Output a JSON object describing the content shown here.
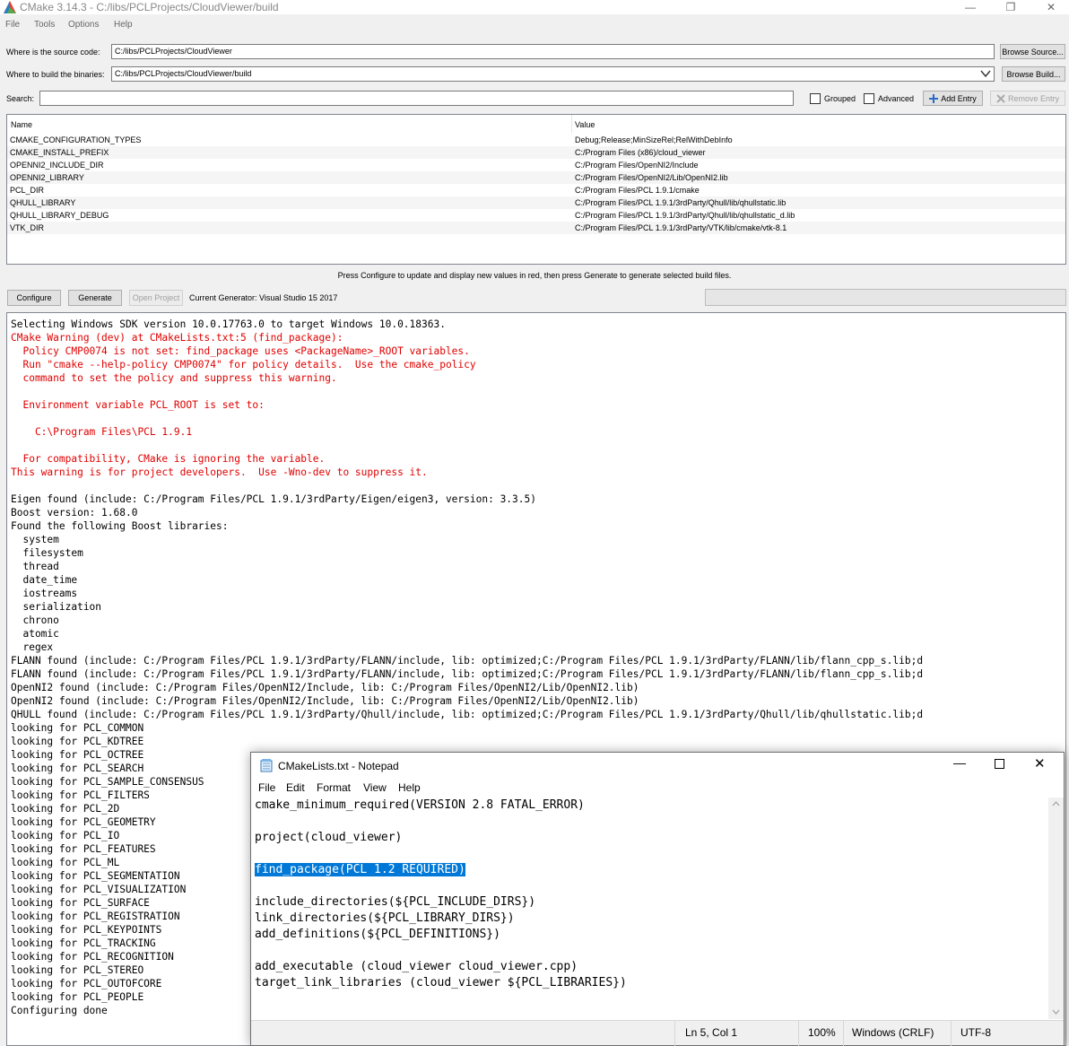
{
  "window": {
    "title": "CMake 3.14.3 - C:/libs/PCLProjects/CloudViewer/build",
    "controls": {
      "minimize": "—",
      "restore": "❐",
      "close": "✕"
    }
  },
  "menu": [
    "File",
    "Tools",
    "Options",
    "Help"
  ],
  "source": {
    "label": "Where is the source code:",
    "value": "C:/libs/PCLProjects/CloudViewer",
    "browse": "Browse Source..."
  },
  "build": {
    "label": "Where to build the binaries:",
    "value": "C:/libs/PCLProjects/CloudViewer/build",
    "browse": "Browse Build..."
  },
  "search": {
    "label": "Search:",
    "value": ""
  },
  "options": {
    "grouped": "Grouped",
    "advanced": "Advanced",
    "add_entry": "Add Entry",
    "remove_entry": "Remove Entry"
  },
  "cache_table": {
    "headers": [
      "Name",
      "Value"
    ],
    "rows": [
      [
        "CMAKE_CONFIGURATION_TYPES",
        "Debug;Release;MinSizeRel;RelWithDebInfo"
      ],
      [
        "CMAKE_INSTALL_PREFIX",
        "C:/Program Files (x86)/cloud_viewer"
      ],
      [
        "OPENNI2_INCLUDE_DIR",
        "C:/Program Files/OpenNI2/Include"
      ],
      [
        "OPENNI2_LIBRARY",
        "C:/Program Files/OpenNI2/Lib/OpenNI2.lib"
      ],
      [
        "PCL_DIR",
        "C:/Program Files/PCL 1.9.1/cmake"
      ],
      [
        "QHULL_LIBRARY",
        "C:/Program Files/PCL 1.9.1/3rdParty/Qhull/lib/qhullstatic.lib"
      ],
      [
        "QHULL_LIBRARY_DEBUG",
        "C:/Program Files/PCL 1.9.1/3rdParty/Qhull/lib/qhullstatic_d.lib"
      ],
      [
        "VTK_DIR",
        "C:/Program Files/PCL 1.9.1/3rdParty/VTK/lib/cmake/vtk-8.1"
      ]
    ]
  },
  "hint": "Press Configure to update and display new values in red, then press Generate to generate selected build files.",
  "actions": {
    "configure": "Configure",
    "generate": "Generate",
    "open_project": "Open Project",
    "generator": "Current Generator: Visual Studio 15 2017"
  },
  "output": [
    {
      "t": "Selecting Windows SDK version 10.0.17763.0 to target Windows 10.0.18363.",
      "c": "n"
    },
    {
      "t": "CMake Warning (dev) at CMakeLists.txt:5 (find_package):",
      "c": "r"
    },
    {
      "t": "  Policy CMP0074 is not set: find_package uses <PackageName>_ROOT variables.",
      "c": "r"
    },
    {
      "t": "  Run \"cmake --help-policy CMP0074\" for policy details.  Use the cmake_policy",
      "c": "r"
    },
    {
      "t": "  command to set the policy and suppress this warning.",
      "c": "r"
    },
    {
      "t": "",
      "c": "r"
    },
    {
      "t": "  Environment variable PCL_ROOT is set to:",
      "c": "r"
    },
    {
      "t": "",
      "c": "r"
    },
    {
      "t": "    C:\\Program Files\\PCL 1.9.1",
      "c": "r"
    },
    {
      "t": "",
      "c": "r"
    },
    {
      "t": "  For compatibility, CMake is ignoring the variable.",
      "c": "r"
    },
    {
      "t": "This warning is for project developers.  Use -Wno-dev to suppress it.",
      "c": "r"
    },
    {
      "t": "",
      "c": "n"
    },
    {
      "t": "Eigen found (include: C:/Program Files/PCL 1.9.1/3rdParty/Eigen/eigen3, version: 3.3.5)",
      "c": "n"
    },
    {
      "t": "Boost version: 1.68.0",
      "c": "n"
    },
    {
      "t": "Found the following Boost libraries:",
      "c": "n"
    },
    {
      "t": "  system",
      "c": "n"
    },
    {
      "t": "  filesystem",
      "c": "n"
    },
    {
      "t": "  thread",
      "c": "n"
    },
    {
      "t": "  date_time",
      "c": "n"
    },
    {
      "t": "  iostreams",
      "c": "n"
    },
    {
      "t": "  serialization",
      "c": "n"
    },
    {
      "t": "  chrono",
      "c": "n"
    },
    {
      "t": "  atomic",
      "c": "n"
    },
    {
      "t": "  regex",
      "c": "n"
    },
    {
      "t": "FLANN found (include: C:/Program Files/PCL 1.9.1/3rdParty/FLANN/include, lib: optimized;C:/Program Files/PCL 1.9.1/3rdParty/FLANN/lib/flann_cpp_s.lib;d",
      "c": "n"
    },
    {
      "t": "FLANN found (include: C:/Program Files/PCL 1.9.1/3rdParty/FLANN/include, lib: optimized;C:/Program Files/PCL 1.9.1/3rdParty/FLANN/lib/flann_cpp_s.lib;d",
      "c": "n"
    },
    {
      "t": "OpenNI2 found (include: C:/Program Files/OpenNI2/Include, lib: C:/Program Files/OpenNI2/Lib/OpenNI2.lib)",
      "c": "n"
    },
    {
      "t": "OpenNI2 found (include: C:/Program Files/OpenNI2/Include, lib: C:/Program Files/OpenNI2/Lib/OpenNI2.lib)",
      "c": "n"
    },
    {
      "t": "QHULL found (include: C:/Program Files/PCL 1.9.1/3rdParty/Qhull/include, lib: optimized;C:/Program Files/PCL 1.9.1/3rdParty/Qhull/lib/qhullstatic.lib;d",
      "c": "n"
    },
    {
      "t": "looking for PCL_COMMON",
      "c": "n"
    },
    {
      "t": "looking for PCL_KDTREE",
      "c": "n"
    },
    {
      "t": "looking for PCL_OCTREE",
      "c": "n"
    },
    {
      "t": "looking for PCL_SEARCH",
      "c": "n"
    },
    {
      "t": "looking for PCL_SAMPLE_CONSENSUS",
      "c": "n"
    },
    {
      "t": "looking for PCL_FILTERS",
      "c": "n"
    },
    {
      "t": "looking for PCL_2D",
      "c": "n"
    },
    {
      "t": "looking for PCL_GEOMETRY",
      "c": "n"
    },
    {
      "t": "looking for PCL_IO",
      "c": "n"
    },
    {
      "t": "looking for PCL_FEATURES",
      "c": "n"
    },
    {
      "t": "looking for PCL_ML",
      "c": "n"
    },
    {
      "t": "looking for PCL_SEGMENTATION",
      "c": "n"
    },
    {
      "t": "looking for PCL_VISUALIZATION",
      "c": "n"
    },
    {
      "t": "looking for PCL_SURFACE",
      "c": "n"
    },
    {
      "t": "looking for PCL_REGISTRATION",
      "c": "n"
    },
    {
      "t": "looking for PCL_KEYPOINTS",
      "c": "n"
    },
    {
      "t": "looking for PCL_TRACKING",
      "c": "n"
    },
    {
      "t": "looking for PCL_RECOGNITION",
      "c": "n"
    },
    {
      "t": "looking for PCL_STEREO",
      "c": "n"
    },
    {
      "t": "looking for PCL_OUTOFCORE",
      "c": "n"
    },
    {
      "t": "looking for PCL_PEOPLE",
      "c": "n"
    },
    {
      "t": "Configuring done",
      "c": "n"
    }
  ],
  "notepad": {
    "title": "CMakeLists.txt - Notepad",
    "menu": [
      "File",
      "Edit",
      "Format",
      "View",
      "Help"
    ],
    "lines": [
      "cmake_minimum_required(VERSION 2.8 FATAL_ERROR)",
      "",
      "project(cloud_viewer)",
      "",
      "find_package(PCL 1.2 REQUIRED)",
      "",
      "include_directories(${PCL_INCLUDE_DIRS})",
      "link_directories(${PCL_LIBRARY_DIRS})",
      "add_definitions(${PCL_DEFINITIONS})",
      "",
      "add_executable (cloud_viewer cloud_viewer.cpp)",
      "target_link_libraries (cloud_viewer ${PCL_LIBRARIES})"
    ],
    "selected_line": 4,
    "status": {
      "position": "Ln 5, Col 1",
      "zoom": "100%",
      "eol": "Windows (CRLF)",
      "encoding": "UTF-8"
    }
  }
}
